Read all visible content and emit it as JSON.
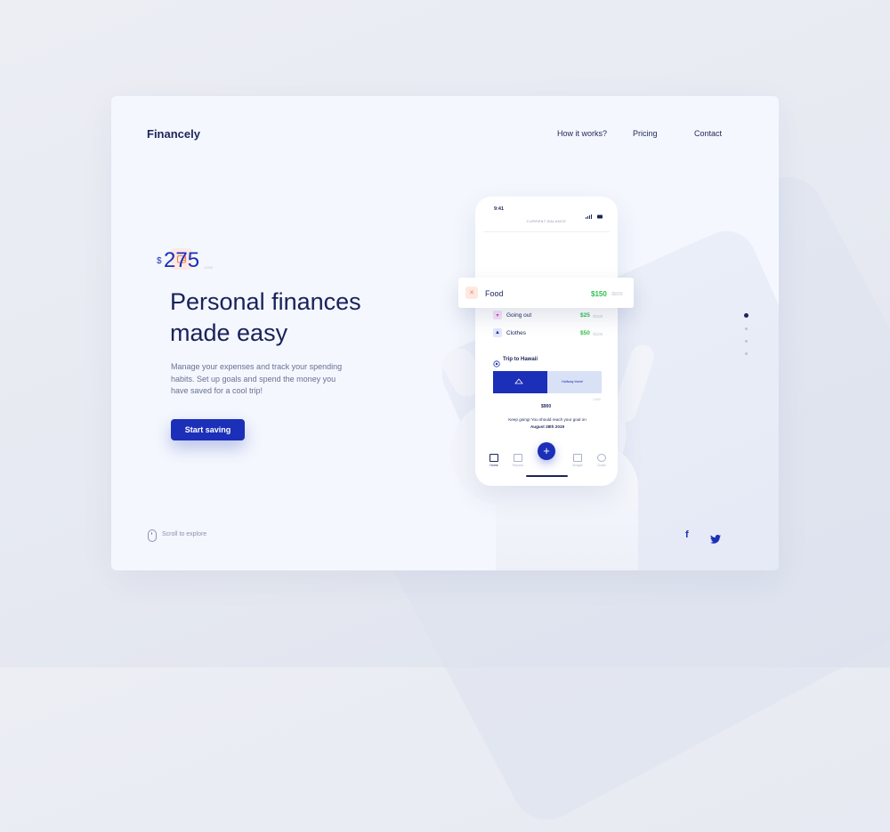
{
  "brand": {
    "name": "Financely"
  },
  "nav": [
    {
      "label": "How it works?"
    },
    {
      "label": "Pricing"
    },
    {
      "label": "Contact"
    }
  ],
  "hero": {
    "title_line1": "Personal finances",
    "title_line2": "made easy",
    "description": "Manage your expenses and track your spending habits. Set up goals and spend the money you have saved for a cool trip!",
    "cta_label": "Start saving"
  },
  "scroll_hint": "Scroll to explore",
  "pagination": {
    "total": 4,
    "active": 1
  },
  "social": [
    {
      "icon": "facebook-icon"
    },
    {
      "icon": "twitter-icon"
    }
  ],
  "colors": {
    "primary": "#1b2fb8",
    "positive": "#2ec24d",
    "accent_orange": "#f0825a"
  },
  "phone": {
    "time": "9:41",
    "balance_label": "CURRENT BALANCE",
    "currency": "$",
    "balance": "275",
    "balance_sub": "/1250",
    "food": {
      "label": "Food",
      "amount": "$150",
      "total": "/$800"
    },
    "rows": [
      {
        "label": "Going out",
        "amount": "$25",
        "total": "/$180"
      },
      {
        "label": "Clothes",
        "amount": "$50",
        "total": "/$100"
      }
    ],
    "goal": {
      "title": "Trip to Hawaii",
      "progress": 0.5,
      "bar_note": "Halfway there!",
      "amount": "$900",
      "max": "1,800",
      "message_line1": "Keep going! You should reach your goal on",
      "message_line2": "August 28th 2019"
    },
    "tabs": [
      {
        "label": "Home"
      },
      {
        "label": "Reports"
      },
      {
        "label": "Budget"
      },
      {
        "label": "Goals"
      }
    ]
  }
}
